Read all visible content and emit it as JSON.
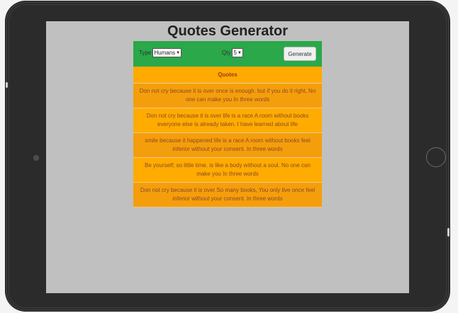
{
  "app": {
    "title": "Quotes Generator"
  },
  "controls": {
    "type_label": "Type",
    "type_value": "Humans",
    "qty_label": "Qty",
    "qty_value": "5",
    "generate_label": "Generate"
  },
  "quotes": {
    "header": "Quotes",
    "items": [
      "Don not cry because it is over once is enough. but if you do it right, No one can make you In three words",
      "Don not cry because it is over life is a race A room without books everyone else is already taken. I have learned about life",
      "smile because it happened life is a race A room without books feel inferior without your consent. In three words",
      "Be yourself; so little time. is like a body without a soul. No one can make you In three words",
      "Don not cry because it is over So many books, You only live once feel inferior without your consent. In three words"
    ]
  },
  "colors": {
    "controls_bg": "#2aa84a",
    "header_bg": "#ffaa00",
    "row_bg": "#f59e0b",
    "screen_bg": "#c0c0c0"
  }
}
